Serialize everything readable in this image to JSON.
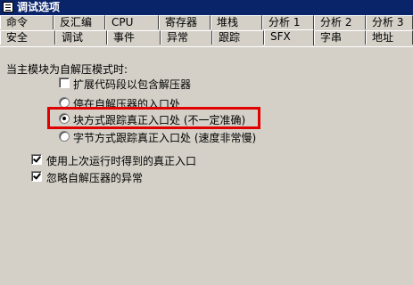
{
  "window": {
    "title": "调试选项"
  },
  "tabs_row1": [
    "命令",
    "反汇编",
    "CPU",
    "寄存器",
    "堆栈",
    "分析 1",
    "分析 2",
    "分析 3"
  ],
  "tabs_row2": [
    "安全",
    "调试",
    "事件",
    "异常",
    "跟踪",
    "SFX",
    "字串",
    "地址"
  ],
  "active_tab": "SFX",
  "sfx": {
    "group_label": "当主模块为自解压模式时:",
    "extend_code_label": "扩展代码段以包含解压器",
    "extend_code_checked": false,
    "radio_stop_label": "停在自解压器的入口处",
    "radio_block_label": "块方式跟踪真正入口处 (不一定准确)",
    "radio_byte_label": "字节方式跟踪真正入口处 (速度非常慢)",
    "selected_radio": "block",
    "use_last_label": "使用上次运行时得到的真正入口",
    "use_last_checked": true,
    "ignore_exceptions_label": "忽略自解压器的异常",
    "ignore_exceptions_checked": true
  },
  "highlight_color": "#e00000"
}
